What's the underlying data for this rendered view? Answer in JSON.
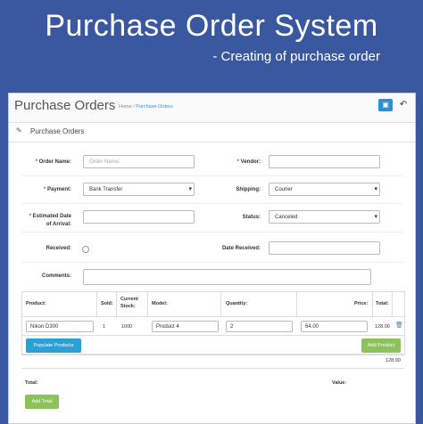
{
  "hero": {
    "title": "Purchase Order System",
    "subtitle": "- Creating of purchase order"
  },
  "header": {
    "title": "Purchase Orders",
    "breadcrumb_home": "Home",
    "breadcrumb_sep": "/",
    "breadcrumb_current": "Purchase Orders"
  },
  "section": {
    "title": "Purchase Orders"
  },
  "form": {
    "order_name_label": "Order Name:",
    "order_name_placeholder": "Order Name:",
    "vendor_label": "Vendor:",
    "payment_label": "Payment:",
    "payment_value": "Bank Transfer",
    "shipping_label": "Shipping:",
    "shipping_value": "Courier",
    "arrival_label_1": "Estimated Date",
    "arrival_label_2": "of Arrival:",
    "status_label": "Status:",
    "status_value": "Canceled",
    "received_label": "Received:",
    "date_received_label": "Date Received:",
    "comments_label": "Comments:",
    "required_mark": "*"
  },
  "table": {
    "headers": [
      "Product:",
      "Sold:",
      "Current Stock:",
      "Model:",
      "Quantity:",
      "Price:",
      "Total:"
    ],
    "row": {
      "product": "Nikon D300",
      "sold": "1",
      "stock": "1000",
      "model": "Product 4",
      "quantity": "2",
      "price": "64.00",
      "total": "128.00"
    },
    "populate_label": "Populate Products",
    "add_product_label": "Add Product",
    "sum": "128.00"
  },
  "footer": {
    "total_label": "Total:",
    "value_label": "Value:",
    "add_total_label": "Add Total"
  },
  "colors": {
    "background": "#3a58a0",
    "blue_button": "#2aa0d8",
    "green_button": "#8cc25a",
    "link": "#3b8ecf"
  },
  "icons": {
    "save": "floppy-icon",
    "back": "reply-arrow-icon",
    "edit": "pencil-icon",
    "delete": "trash-icon"
  }
}
